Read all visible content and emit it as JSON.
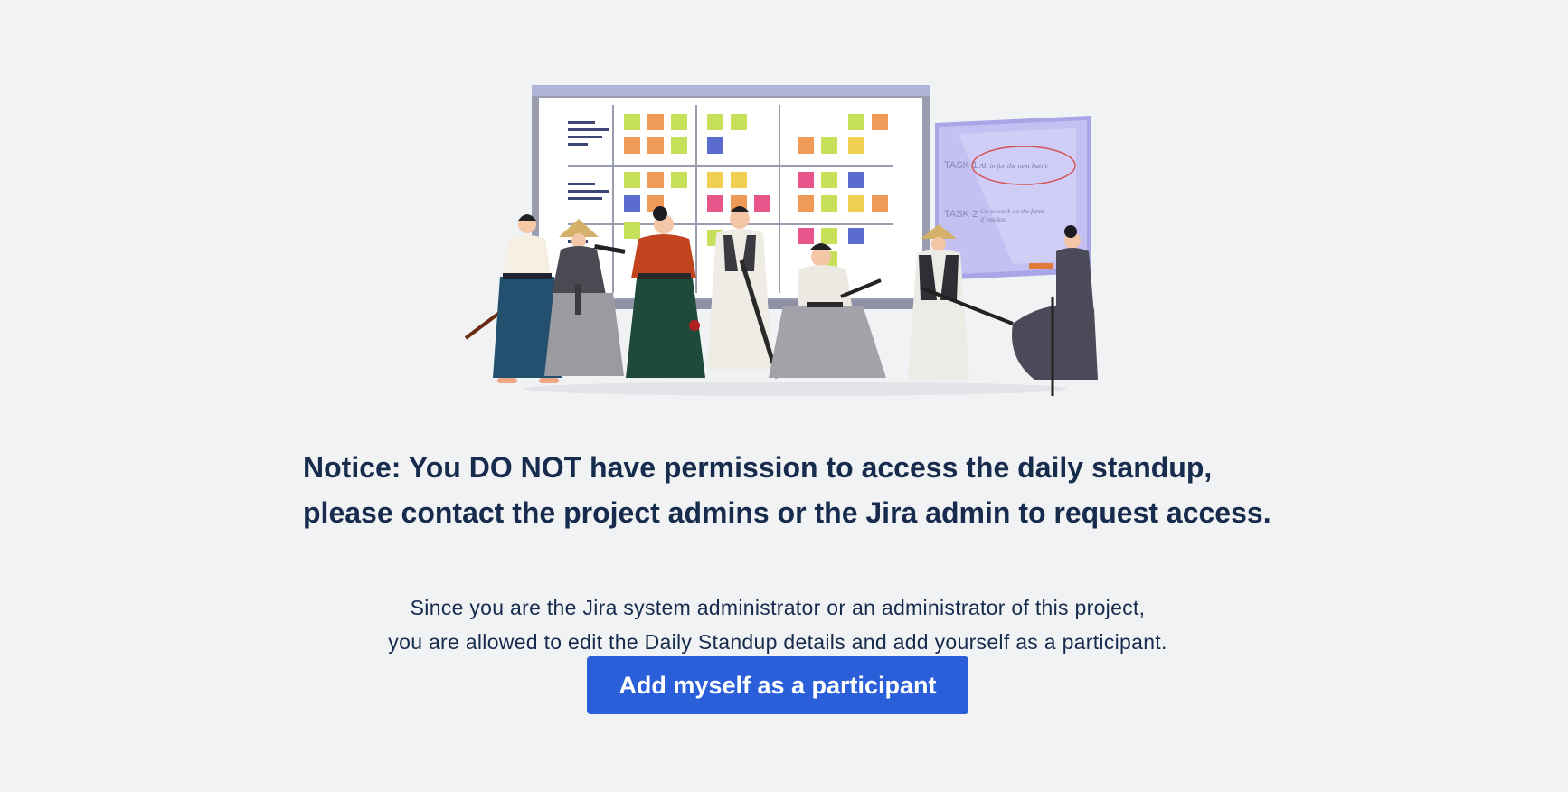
{
  "notice": {
    "line1": "Notice: You DO NOT have permission to access the daily standup,",
    "line2": "please contact the project admins or the Jira admin to request access."
  },
  "description": {
    "line1": "Since you are the Jira system administrator or an administrator of this project,",
    "line2": "you are allowed to edit the Daily Standup details and add yourself as a participant."
  },
  "actions": {
    "add_participant_label": "Add myself as a participant"
  },
  "illustration": {
    "whiteboard_task1_label": "TASK 1",
    "whiteboard_task1_text": "All in for the next battle",
    "whiteboard_task2_label": "TASK 2",
    "whiteboard_task2_text_line1": "Go to work on the farm",
    "whiteboard_task2_text_line2": "if you lost"
  },
  "colors": {
    "background": "#f0f2f4",
    "text": "#172b4d",
    "primary_button": "#2a5fd9"
  }
}
